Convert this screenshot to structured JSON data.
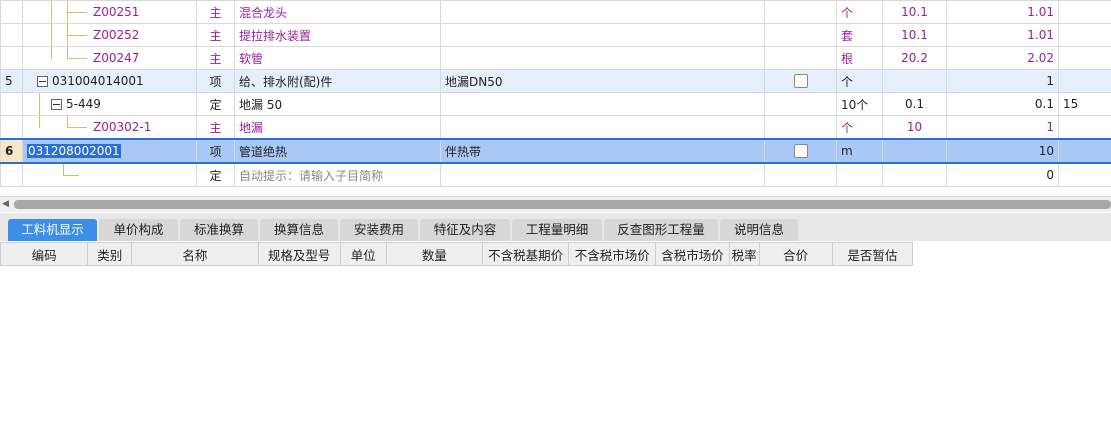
{
  "rows": [
    {
      "idx": "",
      "code": "Z00251",
      "type": "主",
      "name": "混合龙头",
      "spec": "",
      "unit": "个",
      "qty1": "10.1",
      "qty2": "1.01",
      "extra": ""
    },
    {
      "idx": "",
      "code": "Z00252",
      "type": "主",
      "name": "提拉排水装置",
      "spec": "",
      "unit": "套",
      "qty1": "10.1",
      "qty2": "1.01",
      "extra": ""
    },
    {
      "idx": "",
      "code": "Z00247",
      "type": "主",
      "name": "软管",
      "spec": "",
      "unit": "根",
      "qty1": "20.2",
      "qty2": "2.02",
      "extra": ""
    },
    {
      "idx": "5",
      "code": "031004014001",
      "type": "项",
      "name": "给、排水附(配)件",
      "spec": "地漏DN50",
      "unit": "个",
      "qty1": "",
      "qty2": "1",
      "extra": ""
    },
    {
      "idx": "",
      "code": "5-449",
      "type": "定",
      "name": "地漏 50",
      "spec": "",
      "unit": "10个",
      "qty1": "0.1",
      "qty2": "0.1",
      "extra": "15"
    },
    {
      "idx": "",
      "code": "Z00302-1",
      "type": "主",
      "name": "地漏",
      "spec": "",
      "unit": "个",
      "qty1": "10",
      "qty2": "1",
      "extra": ""
    },
    {
      "idx": "6",
      "code": "031208002001",
      "type": "项",
      "name": "管道绝热",
      "spec": "伴热带",
      "unit": "m",
      "qty1": "",
      "qty2": "10",
      "extra": ""
    },
    {
      "idx": "",
      "code": "",
      "type": "定",
      "name": "自动提示：请输入子目简称",
      "spec": "",
      "unit": "",
      "qty1": "",
      "qty2": "0",
      "extra": ""
    }
  ],
  "tabs": [
    "工料机显示",
    "单价构成",
    "标准换算",
    "换算信息",
    "安装费用",
    "特征及内容",
    "工程量明细",
    "反查图形工程量",
    "说明信息"
  ],
  "sub_headers": [
    "编码",
    "类别",
    "名称",
    "规格及型号",
    "单位",
    "数量",
    "不含税基期价",
    "不含税市场价",
    "含税市场价",
    "税率",
    "合价",
    "是否暂估"
  ],
  "colors": {
    "accent": "#3c8ee6",
    "selected_row": "#a9c8f5",
    "item_row": "#e6eefb",
    "main_material": "#9b1f9b"
  }
}
